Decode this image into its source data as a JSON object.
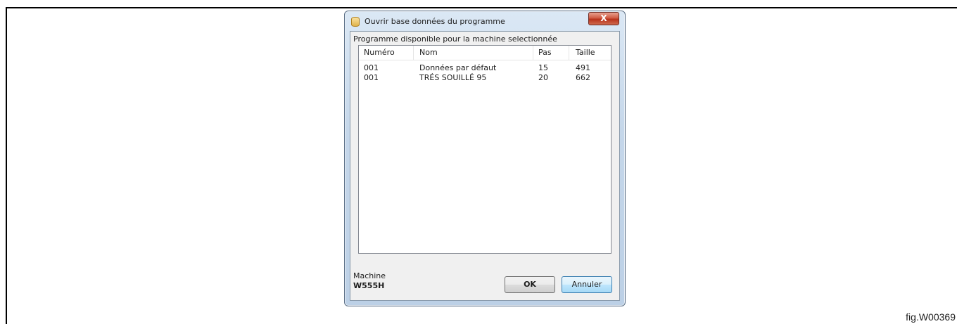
{
  "window": {
    "title": "Ouvrir base données du programme",
    "close_glyph": "X",
    "icon": "database-icon"
  },
  "list": {
    "section_label": "Programme disponible pour la machine selectionnée",
    "columns": [
      "Numéro",
      "Nom",
      "Pas",
      "Taille"
    ],
    "rows": [
      {
        "numero": "001",
        "nom": "Données par défaut",
        "pas": "15",
        "taille": "491"
      },
      {
        "numero": "001",
        "nom": "TRÉS SOUILLÉ 95",
        "pas": "20",
        "taille": "662"
      }
    ]
  },
  "machine": {
    "label": "Machine",
    "value": "W555H"
  },
  "buttons": {
    "ok": "OK",
    "cancel": "Annuler"
  },
  "figure": {
    "label": "fig.W00369"
  }
}
